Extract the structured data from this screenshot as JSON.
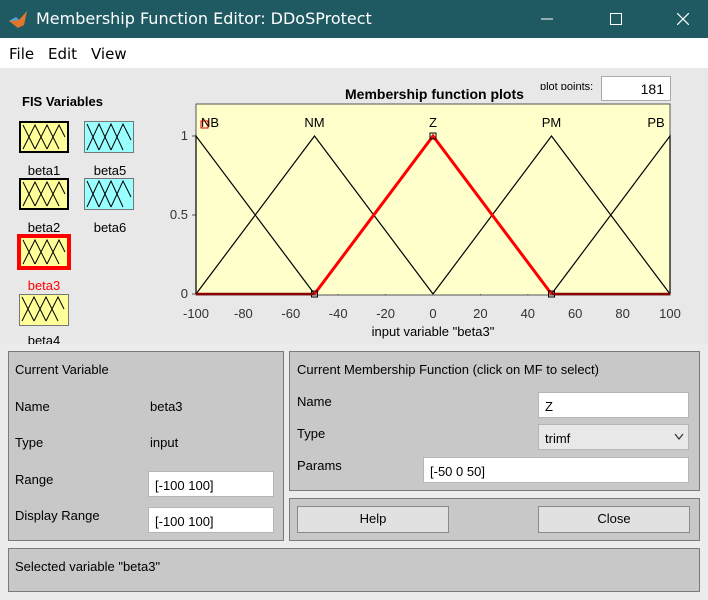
{
  "window": {
    "title": "Membership Function Editor: DDoSProtect"
  },
  "menu": [
    "File",
    "Edit",
    "View"
  ],
  "fis": {
    "heading": "FIS Variables",
    "variables": [
      {
        "name": "beta1",
        "kind": "input",
        "selected": false
      },
      {
        "name": "beta2",
        "kind": "input",
        "selected": false
      },
      {
        "name": "beta3",
        "kind": "input",
        "selected": true
      },
      {
        "name": "beta4",
        "kind": "input",
        "selected": false
      },
      {
        "name": "beta5",
        "kind": "output",
        "selected": false
      },
      {
        "name": "beta6",
        "kind": "output",
        "selected": false
      }
    ],
    "colors": {
      "input": "#ffff99",
      "output": "#99ffff",
      "selected_border": "#ff0000"
    }
  },
  "plot": {
    "title": "Membership function plots",
    "plot_points_label": "plot points:",
    "plot_points_value": "181",
    "xlabel": "input variable \"beta3\"",
    "xticks": [
      "-100",
      "-80",
      "-60",
      "-40",
      "-20",
      "0",
      "20",
      "40",
      "60",
      "80",
      "100"
    ],
    "yticks": [
      "0",
      "0.5",
      "1"
    ]
  },
  "chart_data": {
    "type": "line",
    "xlim": [
      -100,
      100
    ],
    "ylim": [
      0,
      1
    ],
    "background": "#ffffcc",
    "series": [
      {
        "name": "NB",
        "x": [
          -100,
          -100,
          -50
        ],
        "y": [
          0,
          1,
          0
        ],
        "selected": false
      },
      {
        "name": "NM",
        "x": [
          -100,
          -50,
          0
        ],
        "y": [
          0,
          1,
          0
        ],
        "selected": false
      },
      {
        "name": "Z",
        "x": [
          -50,
          0,
          50
        ],
        "y": [
          0,
          1,
          0
        ],
        "selected": true
      },
      {
        "name": "PM",
        "x": [
          0,
          50,
          100
        ],
        "y": [
          0,
          1,
          0
        ],
        "selected": false
      },
      {
        "name": "PB",
        "x": [
          50,
          100,
          100
        ],
        "y": [
          0,
          1,
          0
        ],
        "selected": false
      }
    ],
    "selected_color": "#ff0000",
    "line_color": "#000000"
  },
  "current_variable": {
    "heading": "Current Variable",
    "name_label": "Name",
    "name_value": "beta3",
    "type_label": "Type",
    "type_value": "input",
    "range_label": "Range",
    "range_value": "[-100 100]",
    "display_range_label": "Display Range",
    "display_range_value": "[-100 100]"
  },
  "current_mf": {
    "heading": "Current Membership Function (click on MF to select)",
    "name_label": "Name",
    "name_value": "Z",
    "type_label": "Type",
    "type_value": "trimf",
    "params_label": "Params",
    "params_value": "[-50 0 50]"
  },
  "buttons": {
    "help": "Help",
    "close": "Close"
  },
  "status": {
    "text": "Selected variable \"beta3\""
  }
}
